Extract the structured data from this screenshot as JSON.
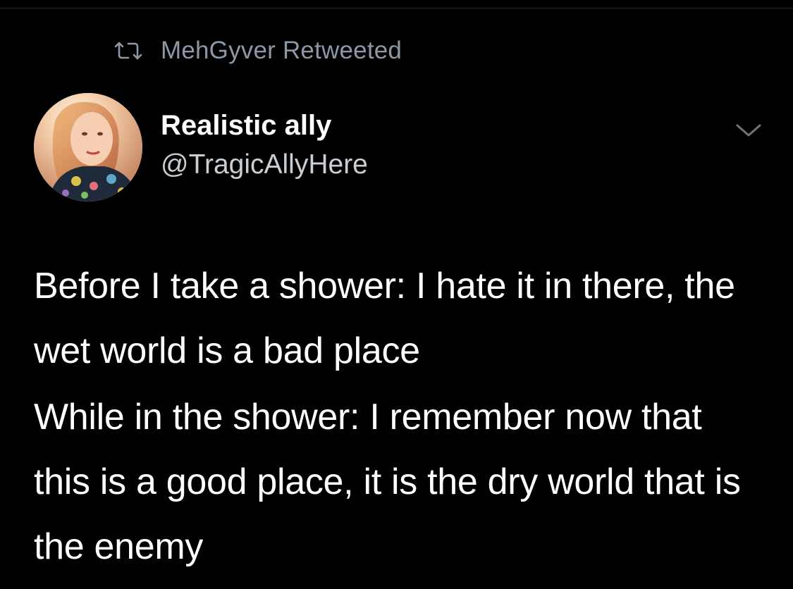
{
  "social_context": {
    "icon": "retweet-icon",
    "text": "MehGyver Retweeted"
  },
  "author": {
    "display_name": "Realistic ally",
    "handle": "@TragicAllyHere",
    "avatar_icon": "profile-photo"
  },
  "menu": {
    "icon": "chevron-down-icon"
  },
  "tweet": {
    "paragraphs": [
      "Before I take a shower: I hate it in there, the wet world is a bad place",
      "While in the shower: I remember now that this is a good place, it is the dry world that is the enemy"
    ]
  },
  "colors": {
    "background": "#000000",
    "primary_text": "#ffffff",
    "secondary_text": "#8b98a5"
  }
}
